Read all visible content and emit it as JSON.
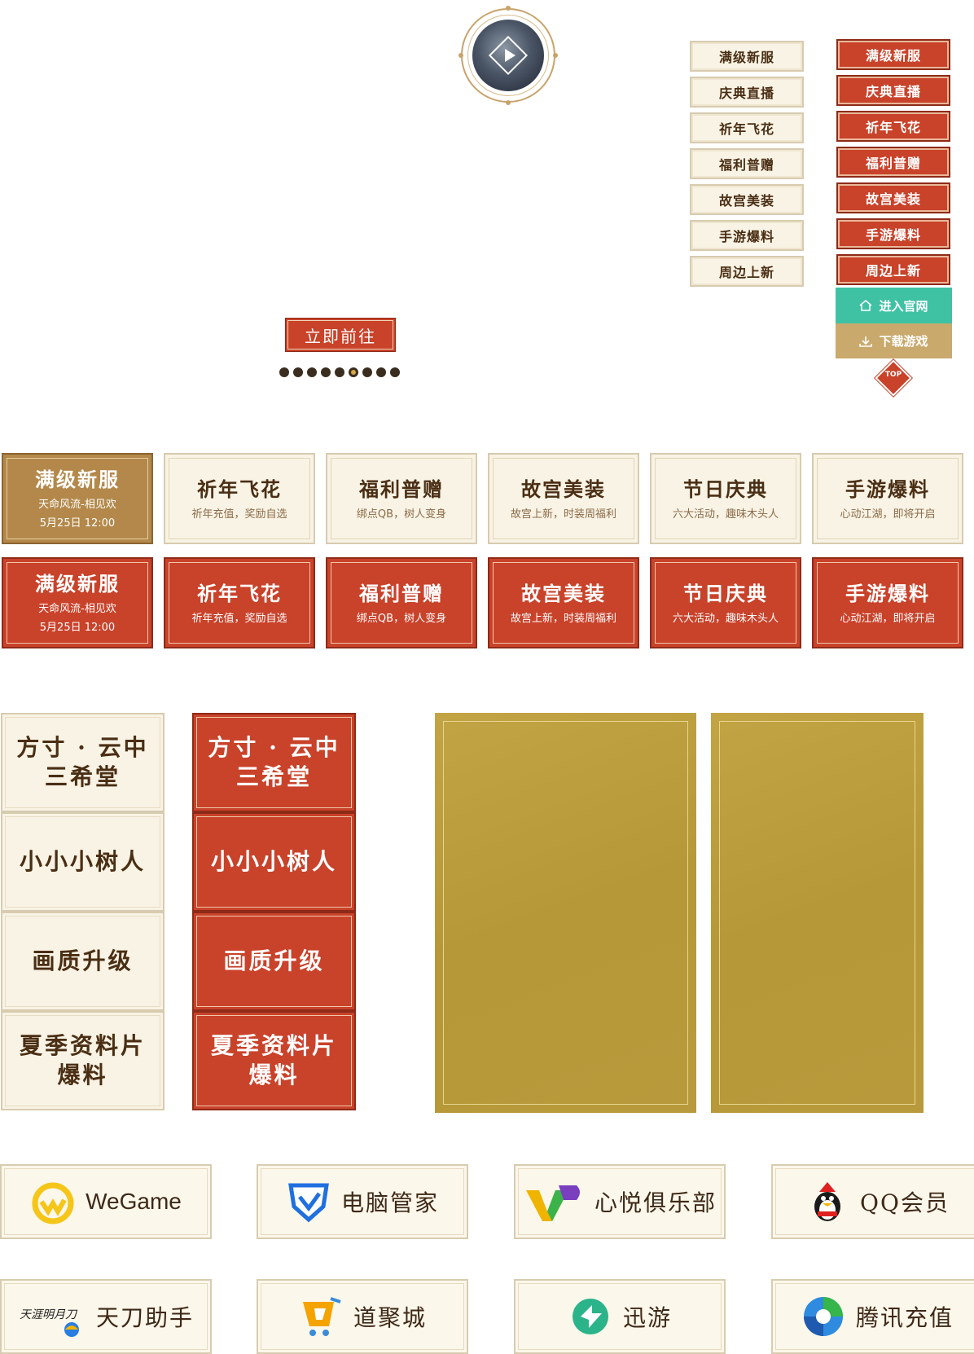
{
  "video": {
    "play_label": ""
  },
  "go_button": "立即前往",
  "pager": {
    "count": 9,
    "active_index": 5
  },
  "side_nav_cream": [
    "满级新服",
    "庆典直播",
    "祈年飞花",
    "福利普赠",
    "故宫美装",
    "手游爆料",
    "周边上新"
  ],
  "side_nav_red": [
    "满级新服",
    "庆典直播",
    "祈年飞花",
    "福利普赠",
    "故宫美装",
    "手游爆料",
    "周边上新"
  ],
  "side_actions": {
    "official_site": "进入官网",
    "download": "下载游戏",
    "top": "TOP"
  },
  "event_cards_row1": [
    {
      "title": "满级新服",
      "sub": "天命风流-相见欢",
      "date": "5月25日 12:00"
    },
    {
      "title": "祈年飞花",
      "sub": "祈年充值，奖励自选"
    },
    {
      "title": "福利普赠",
      "sub": "绑点QB，树人变身"
    },
    {
      "title": "故宫美装",
      "sub": "故宫上新，时装周福利"
    },
    {
      "title": "节日庆典",
      "sub": "六大活动，趣味木头人"
    },
    {
      "title": "手游爆料",
      "sub": "心动江湖，即将开启"
    }
  ],
  "event_cards_row2": [
    {
      "title": "满级新服",
      "sub": "天命风流-相见欢",
      "date": "5月25日 12:00"
    },
    {
      "title": "祈年飞花",
      "sub": "祈年充值，奖励自选"
    },
    {
      "title": "福利普赠",
      "sub": "绑点QB，树人变身"
    },
    {
      "title": "故宫美装",
      "sub": "故宫上新，时装周福利"
    },
    {
      "title": "节日庆典",
      "sub": "六大活动，趣味木头人"
    },
    {
      "title": "手游爆料",
      "sub": "心动江湖，即将开启"
    }
  ],
  "vertical_list_cream": [
    "方寸 · 云中\n三希堂",
    "小小小树人",
    "画质升级",
    "夏季资料片\n爆料"
  ],
  "vertical_list_red": [
    "方寸 · 云中\n三希堂",
    "小小小树人",
    "画质升级",
    "夏季资料片\n爆料"
  ],
  "partners": [
    {
      "label": "WeGame",
      "icon": "wegame-icon"
    },
    {
      "label": "电脑管家",
      "icon": "pc-manager-icon"
    },
    {
      "label": "心悦俱乐部",
      "icon": "xinyue-club-icon"
    },
    {
      "label": "QQ会员",
      "icon": "qq-penguin-icon"
    },
    {
      "label": "天刀助手",
      "icon": "tiandao-assistant-icon",
      "logo_text": "天涯明月刀"
    },
    {
      "label": "道聚城",
      "icon": "daojucheng-cart-icon"
    },
    {
      "label": "迅游",
      "icon": "xunyou-icon"
    },
    {
      "label": "腾讯充值",
      "icon": "tencent-recharge-icon"
    }
  ],
  "colors": {
    "red": "#c9422a",
    "cream": "#f8f3e4",
    "gold_card": "#b3884a",
    "green": "#3fc2a4",
    "gold_action": "#c9a96c",
    "panel": "#b89a3c",
    "text_brown": "#4a2e14"
  }
}
